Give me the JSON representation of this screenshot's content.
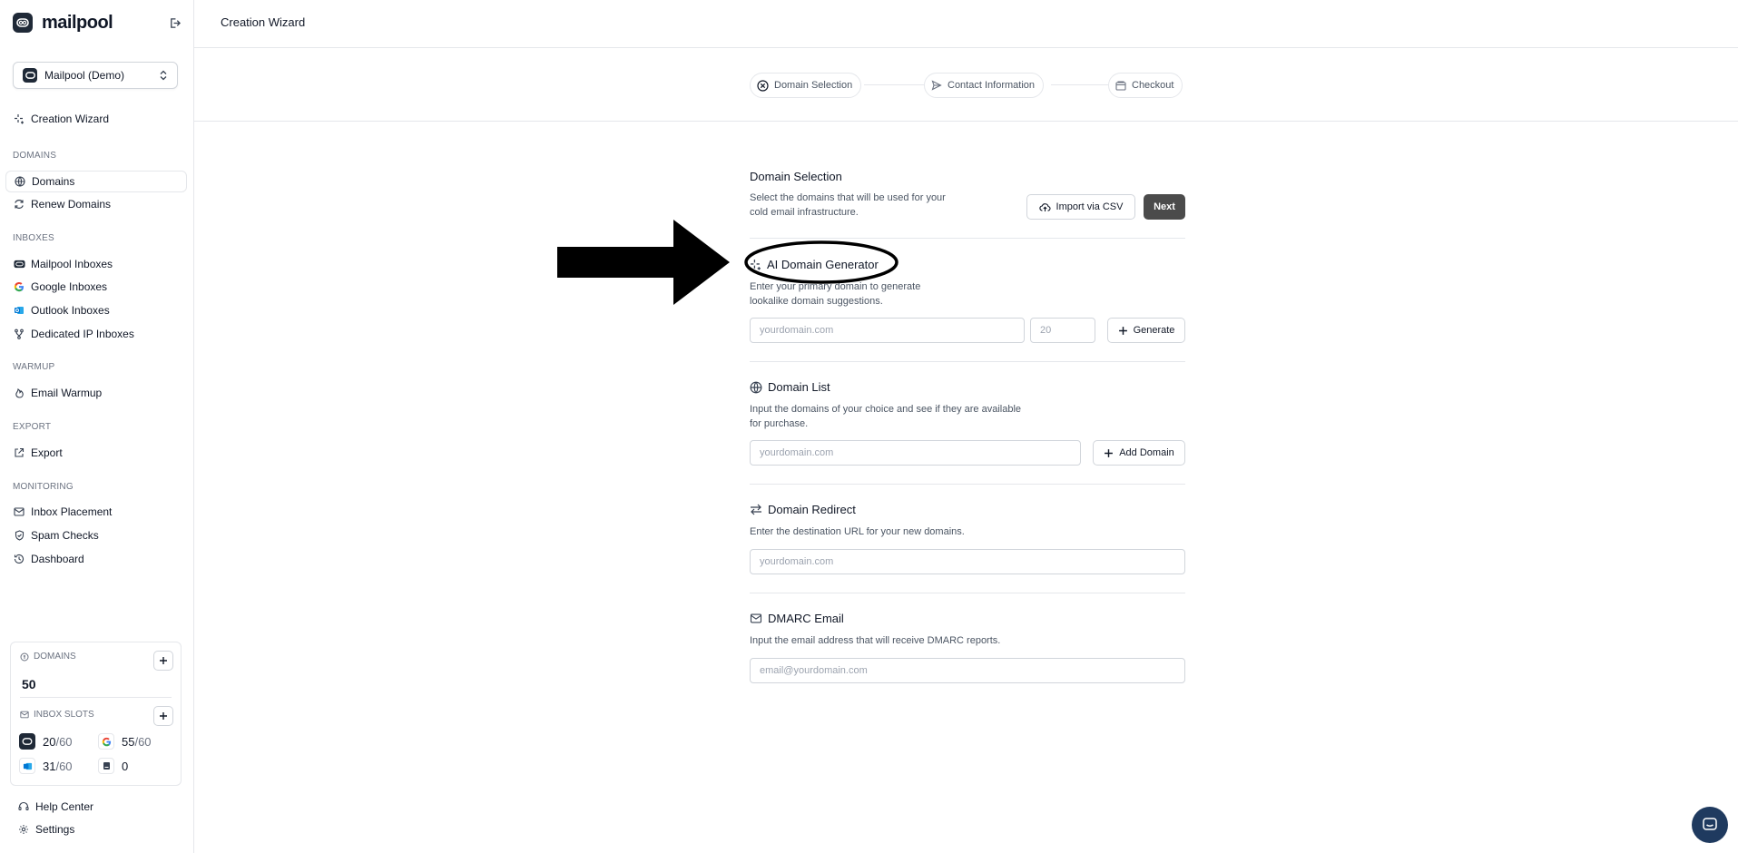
{
  "app": {
    "brand": "mailpool",
    "workspace": "Mailpool (Demo)"
  },
  "nav": {
    "creation_wizard": "Creation Wizard",
    "sections": {
      "domains": "DOMAINS",
      "inboxes": "INBOXES",
      "warmup": "WARMUP",
      "export": "EXPORT",
      "monitoring": "MONITORING"
    },
    "items": {
      "domains": "Domains",
      "renew_domains": "Renew Domains",
      "mailpool_inboxes": "Mailpool Inboxes",
      "google_inboxes": "Google Inboxes",
      "outlook_inboxes": "Outlook Inboxes",
      "dedicated_ip_inboxes": "Dedicated IP Inboxes",
      "email_warmup": "Email Warmup",
      "export": "Export",
      "inbox_placement": "Inbox Placement",
      "spam_checks": "Spam Checks",
      "dashboard": "Dashboard"
    }
  },
  "usage": {
    "domains_label": "DOMAINS",
    "domains_value": "50",
    "inbox_slots_label": "INBOX SLOTS",
    "slots": {
      "mailpool": {
        "used": "20",
        "max": "/60"
      },
      "google": {
        "used": "55",
        "max": "/60"
      },
      "outlook": {
        "used": "31",
        "max": "/60"
      },
      "dedicated": {
        "used": "0"
      }
    }
  },
  "footer": {
    "help_center": "Help Center",
    "settings": "Settings"
  },
  "topbar": {
    "title": "Creation Wizard"
  },
  "stepper": {
    "step1": "Domain Selection",
    "step2": "Contact Information",
    "step3": "Checkout"
  },
  "main": {
    "title": "Domain Selection",
    "subtitle_line1": "Select the domains that will be used for your",
    "subtitle_line2": "cold email infrastructure.",
    "import_csv": "Import via CSV",
    "next": "Next",
    "ai_generator": {
      "title": "AI Domain Generator",
      "desc_line1": "Enter your primary domain to generate",
      "desc_line2": "lookalike domain suggestions.",
      "domain_placeholder": "yourdomain.com",
      "count_placeholder": "20",
      "generate": "Generate"
    },
    "domain_list": {
      "title": "Domain List",
      "desc_line1": "Input the domains of your choice and see if they are available",
      "desc_line2": "for purchase.",
      "placeholder": "yourdomain.com",
      "add": "Add Domain"
    },
    "redirect": {
      "title": "Domain Redirect",
      "desc": "Enter the destination URL for your new domains.",
      "placeholder": "yourdomain.com"
    },
    "dmarc": {
      "title": "DMARC Email",
      "desc": "Input the email address that will receive DMARC reports.",
      "placeholder": "email@yourdomain.com"
    }
  },
  "colors": {
    "brand_dark": "#1f2937",
    "next_button": "#4b4b4b",
    "chat_bubble": "#1f3a5f",
    "google_red": "#ea4335",
    "outlook_blue": "#0078d4"
  }
}
